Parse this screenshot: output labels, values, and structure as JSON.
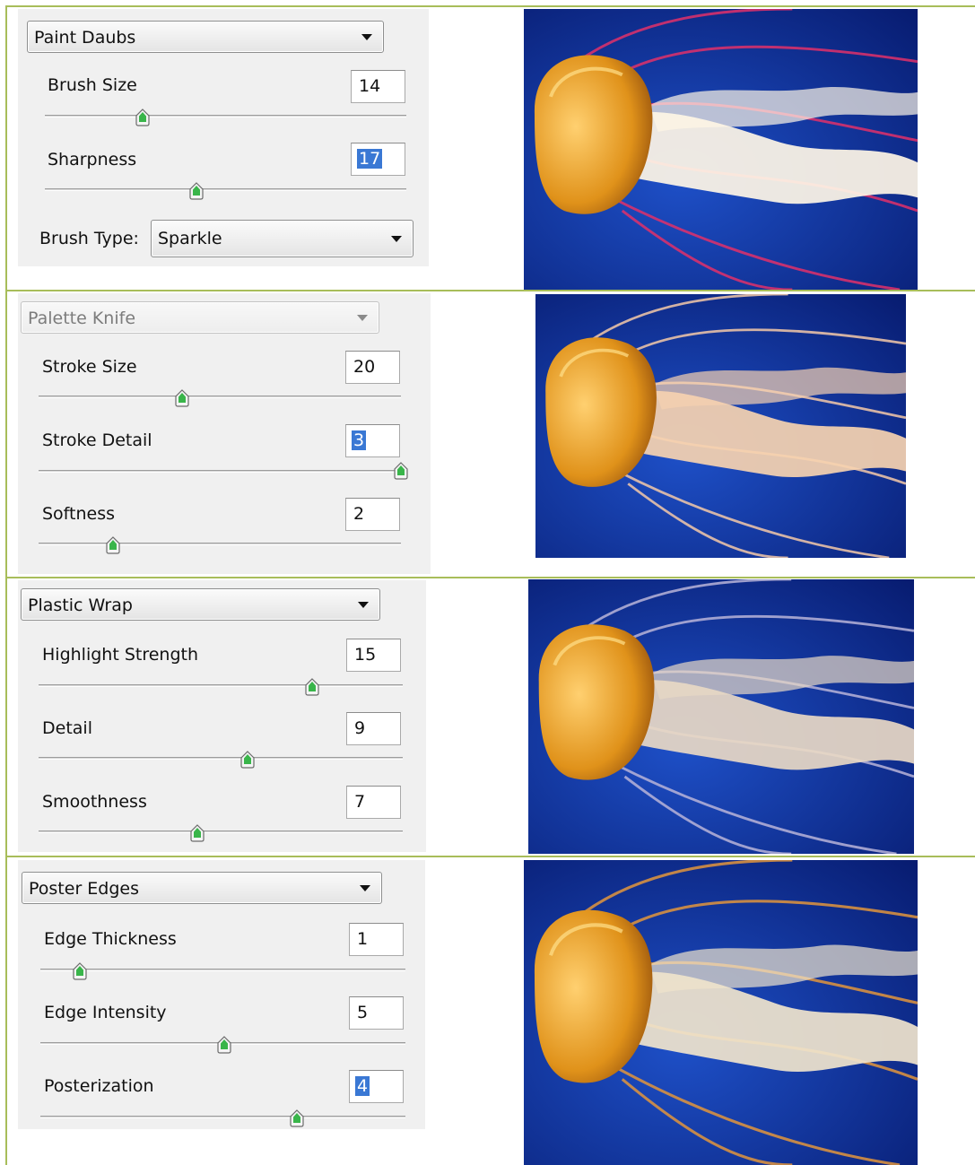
{
  "rows": [
    {
      "filter": "Paint Daubs",
      "disabled": false,
      "params": [
        {
          "label": "Brush Size",
          "value": "14",
          "selected": false,
          "level": 0.28
        },
        {
          "label": "Sharpness",
          "value": "17",
          "selected": true,
          "level": 0.42
        },
        {
          "label": "Brush Type:",
          "type": "select",
          "value": "Sparkle"
        }
      ],
      "preview": "jellyfish-image"
    },
    {
      "filter": "Palette Knife",
      "disabled": true,
      "params": [
        {
          "label": "Stroke Size",
          "value": "20",
          "selected": false,
          "level": 0.39
        },
        {
          "label": "Stroke Detail",
          "value": "3",
          "selected": true,
          "level": 1.0
        },
        {
          "label": "Softness",
          "value": "2",
          "selected": false,
          "level": 0.2
        }
      ],
      "preview": "jellyfish-image"
    },
    {
      "filter": "Plastic Wrap",
      "disabled": false,
      "params": [
        {
          "label": "Highlight Strength",
          "value": "15",
          "selected": false,
          "level": 0.75
        },
        {
          "label": "Detail",
          "value": "9",
          "selected": false,
          "level": 0.57
        },
        {
          "label": "Smoothness",
          "value": "7",
          "selected": false,
          "level": 0.43
        }
      ],
      "preview": "jellyfish-image"
    },
    {
      "filter": "Poster Edges",
      "disabled": false,
      "params": [
        {
          "label": "Edge Thickness",
          "value": "1",
          "selected": false,
          "level": 0.1
        },
        {
          "label": "Edge Intensity",
          "value": "5",
          "selected": false,
          "level": 0.5
        },
        {
          "label": "Posterization",
          "value": "4",
          "selected": true,
          "level": 0.7
        }
      ],
      "preview": "jellyfish-image"
    }
  ],
  "colors": {
    "border": "#a8bd5a",
    "panel": "#f0f0f0",
    "selection": "#3a78d4",
    "water": "#0a2a8f",
    "bell": "#e0921a"
  }
}
